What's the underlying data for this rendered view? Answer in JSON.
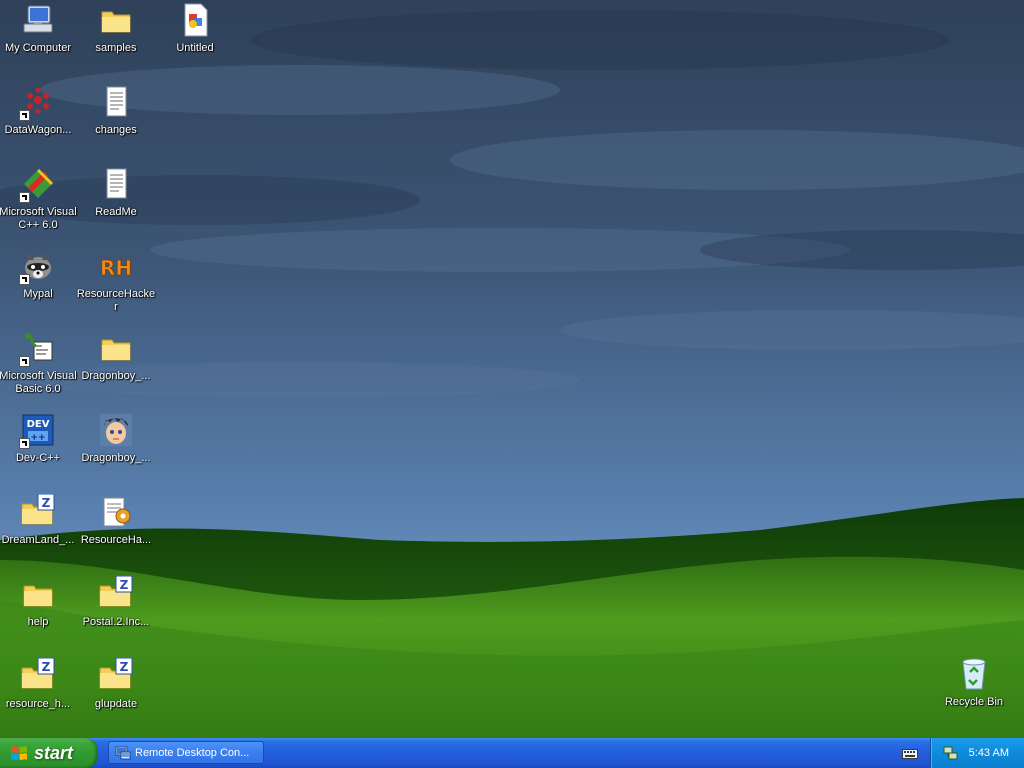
{
  "desktop": {
    "icons": [
      {
        "id": "my-computer",
        "label": "My Computer",
        "icon": "computer-icon"
      },
      {
        "id": "samples",
        "label": "samples",
        "icon": "folder-icon"
      },
      {
        "id": "untitled",
        "label": "Untitled",
        "icon": "paint-document-icon"
      },
      {
        "id": "datawagon",
        "label": "DataWagon...",
        "icon": "datawagon-icon",
        "shortcut": true
      },
      {
        "id": "changes",
        "label": "changes",
        "icon": "text-document-icon"
      },
      {
        "id": "msvc",
        "label": "Microsoft Visual C++ 6.0",
        "icon": "visual-cpp-icon",
        "shortcut": true
      },
      {
        "id": "readme",
        "label": "ReadMe",
        "icon": "text-document-icon"
      },
      {
        "id": "mypal",
        "label": "Mypal",
        "icon": "raccoon-icon",
        "shortcut": true
      },
      {
        "id": "resourcehacker",
        "label": "ResourceHacker",
        "icon": "rh-icon"
      },
      {
        "id": "msvb",
        "label": "Microsoft Visual Basic 6.0",
        "icon": "visual-basic-icon",
        "shortcut": true
      },
      {
        "id": "dragonboy-folder",
        "label": "Dragonboy_...",
        "icon": "folder-icon"
      },
      {
        "id": "devcpp",
        "label": "Dev-C++",
        "icon": "dev-cpp-icon",
        "shortcut": true
      },
      {
        "id": "dragonboy-app",
        "label": "Dragonboy_...",
        "icon": "dragonboy-face-icon"
      },
      {
        "id": "dreamland",
        "label": "DreamLand_...",
        "icon": "zip-folder-icon"
      },
      {
        "id": "resourceha",
        "label": "ResourceHa...",
        "icon": "notepad-gear-icon"
      },
      {
        "id": "help",
        "label": "help",
        "icon": "folder-icon"
      },
      {
        "id": "postal2",
        "label": "Postal.2.Inc...",
        "icon": "zip-folder-icon"
      },
      {
        "id": "resource-h",
        "label": "resource_h...",
        "icon": "zip-folder-icon"
      },
      {
        "id": "glupdate",
        "label": "glupdate",
        "icon": "zip-folder-icon"
      },
      {
        "id": "recycle-bin",
        "label": "Recycle Bin",
        "icon": "recycle-bin-icon"
      }
    ]
  },
  "taskbar": {
    "start_label": "start",
    "tasks": [
      {
        "label": "Remote Desktop Con...",
        "icon": "remote-desktop-icon"
      }
    ],
    "clock": "5:43 AM"
  },
  "colors": {
    "taskbar_blue": "#245ddb",
    "start_green": "#3da83d",
    "tray_blue": "#0f8bdc",
    "sky": "#4a6a92",
    "grass": "#3e8f1c"
  }
}
